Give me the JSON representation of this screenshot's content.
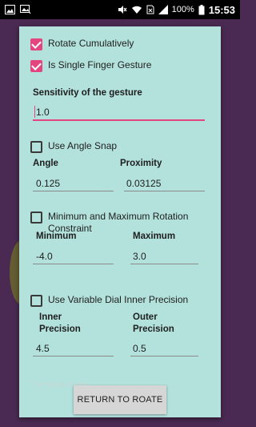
{
  "status_bar": {
    "battery_pct": "100%",
    "time": "15:53"
  },
  "dialog": {
    "rotate_cumulatively": {
      "label": "Rotate Cumulatively",
      "checked": true
    },
    "single_finger": {
      "label": "Is Single Finger Gesture",
      "checked": true
    },
    "sensitivity": {
      "heading": "Sensitivity of the gesture",
      "value": "1.0"
    },
    "angle_snap": {
      "label": "Use Angle Snap",
      "checked": false,
      "angle_heading": "Angle",
      "angle_value": "0.125",
      "proximity_heading": "Proximity",
      "proximity_value": "0.03125"
    },
    "min_max": {
      "label": "Minimum and Maximum Rotation Constraint",
      "checked": false,
      "min_heading": "Minimum",
      "min_value": "-4.0",
      "max_heading": "Maximum",
      "max_value": "3.0"
    },
    "variable_dial": {
      "label": "Use Variable Dial Inner Precision",
      "checked": false,
      "inner_heading": "Inner Precision",
      "inner_value": "4.5",
      "outer_heading": "Outer Precision",
      "outer_value": "0.5"
    },
    "faded_text": "The focus of this",
    "return_button": "RETURN TO ROATE"
  }
}
